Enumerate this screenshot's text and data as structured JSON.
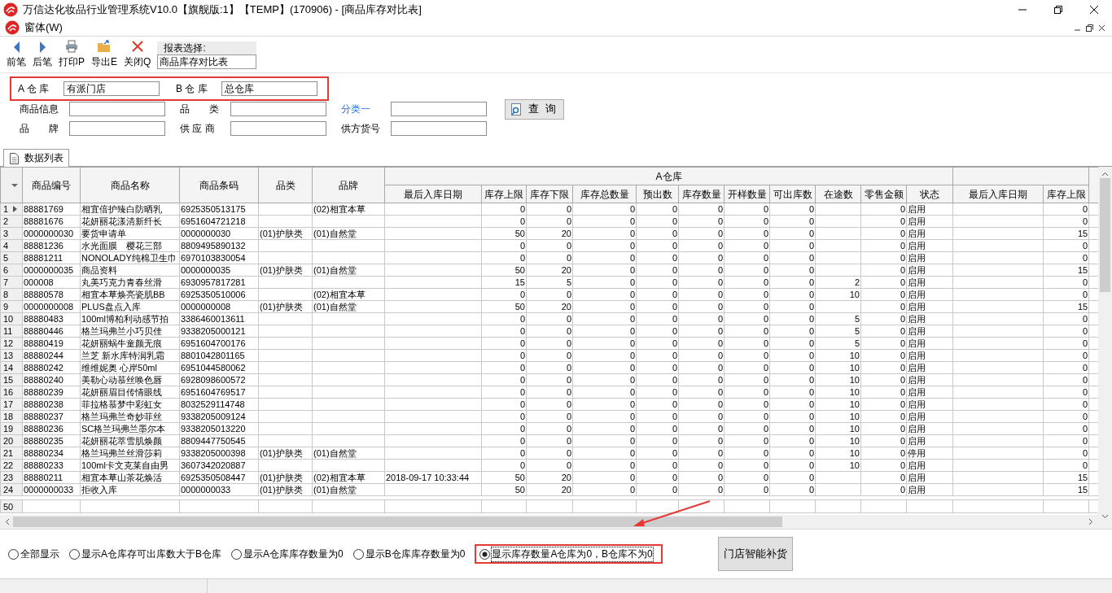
{
  "window": {
    "title": "万信达化妆品行业管理系统V10.0【旗舰版:1】【TEMP】(170906) - [商品库存对比表]"
  },
  "menu": [
    {
      "label": "窗体(W)"
    }
  ],
  "toolbar": {
    "buttons": [
      {
        "label": "前笔"
      },
      {
        "label": "后笔"
      },
      {
        "label": "打印P"
      },
      {
        "label": "导出E"
      },
      {
        "label": "关闭Q"
      }
    ],
    "report_select": {
      "label": "报表选择:",
      "value": "商品库存对比表"
    }
  },
  "filter": {
    "highlighted": true,
    "warehouse_a": {
      "label": "A 仓 库",
      "value": "有派门店"
    },
    "warehouse_b": {
      "label": "B 仓 库",
      "value": "总仓库"
    },
    "fields": [
      {
        "label": "商品信息",
        "kind": "text"
      },
      {
        "label": "品　　类",
        "kind": "text"
      },
      {
        "label": "分类一",
        "kind": "link"
      },
      {
        "label": "品　　牌",
        "kind": "text"
      },
      {
        "label": "供 应 商",
        "kind": "text"
      },
      {
        "label": "供方货号",
        "kind": "text"
      }
    ],
    "query_button": "查 询"
  },
  "tabs": [
    {
      "label": "数据列表",
      "selected": true
    }
  ],
  "grid": {
    "columns": [
      {
        "label": "商品编号"
      },
      {
        "label": "商品名称"
      },
      {
        "label": "商品条码"
      },
      {
        "label": "品类"
      },
      {
        "label": "品牌"
      }
    ],
    "column_groups": [
      {
        "label": "A仓库",
        "columns": [
          {
            "label": "最后入库日期"
          },
          {
            "label": "库存上限"
          },
          {
            "label": "库存下限"
          },
          {
            "label": "库存总数量"
          },
          {
            "label": "预出数"
          },
          {
            "label": "库存数量"
          },
          {
            "label": "开样数量"
          },
          {
            "label": "可出库数"
          },
          {
            "label": "在途数"
          },
          {
            "label": "零售金额"
          },
          {
            "label": "状态"
          }
        ]
      },
      {
        "columns": [
          {
            "label": "最后入库日期"
          },
          {
            "label": "库存上限"
          }
        ]
      }
    ],
    "rows": [
      {
        "header": "1",
        "kind": "data",
        "current": true,
        "cells": [
          "88881769",
          "相宜倍护臻白防晒乳",
          "6925350513175",
          null,
          "(02)相宜本草",
          null,
          "0",
          "0",
          "0",
          "0",
          "0",
          "0",
          "0",
          null,
          "0",
          "启用",
          null,
          "0"
        ]
      },
      {
        "header": "2",
        "kind": "data",
        "current": false,
        "cells": [
          "88881676",
          "花妍丽花漾清新纤长",
          "6951604721218",
          null,
          null,
          null,
          "0",
          "0",
          "0",
          "0",
          "0",
          "0",
          "0",
          null,
          "0",
          "启用",
          null,
          "0"
        ]
      },
      {
        "header": "3",
        "kind": "data",
        "current": false,
        "cells": [
          "0000000030",
          "要货申请单",
          "0000000030",
          "(01)护肤类",
          "(01)自然堂",
          null,
          "50",
          "20",
          "0",
          "0",
          "0",
          "0",
          "0",
          null,
          "0",
          "启用",
          null,
          "15"
        ]
      },
      {
        "header": "4",
        "kind": "data",
        "current": false,
        "cells": [
          "88881236",
          "水光面膜　樱花三部",
          "8809495890132",
          null,
          null,
          null,
          "0",
          "0",
          "0",
          "0",
          "0",
          "0",
          "0",
          null,
          "0",
          "启用",
          null,
          "0"
        ]
      },
      {
        "header": "5",
        "kind": "data",
        "current": false,
        "cells": [
          "88881211",
          "NONOLADY纯棉卫生巾",
          "6970103830054",
          null,
          null,
          null,
          "0",
          "0",
          "0",
          "0",
          "0",
          "0",
          "0",
          null,
          "0",
          "启用",
          null,
          "0"
        ]
      },
      {
        "header": "6",
        "kind": "data",
        "current": false,
        "cells": [
          "0000000035",
          "商品资料",
          "0000000035",
          "(01)护肤类",
          "(01)自然堂",
          null,
          "50",
          "20",
          "0",
          "0",
          "0",
          "0",
          "0",
          null,
          "0",
          "启用",
          null,
          "15"
        ]
      },
      {
        "header": "7",
        "kind": "data",
        "current": false,
        "cells": [
          "000008",
          "丸美巧克力青春丝滑",
          "6930957817281",
          null,
          null,
          null,
          "15",
          "5",
          "0",
          "0",
          "0",
          "0",
          "0",
          "2",
          "0",
          "启用",
          null,
          "0"
        ]
      },
      {
        "header": "8",
        "kind": "data",
        "current": false,
        "cells": [
          "88880578",
          "相宜本草焕亮瓷肌BB",
          "6925350510006",
          null,
          "(02)相宜本草",
          null,
          "0",
          "0",
          "0",
          "0",
          "0",
          "0",
          "0",
          "10",
          "0",
          "启用",
          null,
          "0"
        ]
      },
      {
        "header": "9",
        "kind": "data",
        "current": false,
        "cells": [
          "0000000008",
          "PLUS盘点入库",
          "0000000008",
          "(01)护肤类",
          "(01)自然堂",
          null,
          "50",
          "20",
          "0",
          "0",
          "0",
          "0",
          "0",
          null,
          "0",
          "启用",
          null,
          "15"
        ]
      },
      {
        "header": "10",
        "kind": "data",
        "current": false,
        "cells": [
          "88880483",
          "100ml博柏利动感节拍",
          "3386460013611",
          null,
          null,
          null,
          "0",
          "0",
          "0",
          "0",
          "0",
          "0",
          "0",
          "5",
          "0",
          "启用",
          null,
          "0"
        ]
      },
      {
        "header": "11",
        "kind": "data",
        "current": false,
        "cells": [
          "88880446",
          "格兰玛弗兰小巧贝佳",
          "9338205000121",
          null,
          null,
          null,
          "0",
          "0",
          "0",
          "0",
          "0",
          "0",
          "0",
          "5",
          "0",
          "启用",
          null,
          "0"
        ]
      },
      {
        "header": "12",
        "kind": "data",
        "current": false,
        "cells": [
          "88880419",
          "花妍丽蜗牛童颜无痕",
          "6951604700176",
          null,
          null,
          null,
          "0",
          "0",
          "0",
          "0",
          "0",
          "0",
          "0",
          "5",
          "0",
          "启用",
          null,
          "0"
        ]
      },
      {
        "header": "13",
        "kind": "data",
        "current": false,
        "cells": [
          "88880244",
          "兰芝 新水库特润乳霜",
          "8801042801165",
          null,
          null,
          null,
          "0",
          "0",
          "0",
          "0",
          "0",
          "0",
          "0",
          "10",
          "0",
          "启用",
          null,
          "0"
        ]
      },
      {
        "header": "14",
        "kind": "data",
        "current": false,
        "cells": [
          "88880242",
          "维维妮奥 心岸50ml",
          "6951044580062",
          null,
          null,
          null,
          "0",
          "0",
          "0",
          "0",
          "0",
          "0",
          "0",
          "10",
          "0",
          "启用",
          null,
          "0"
        ]
      },
      {
        "header": "15",
        "kind": "data",
        "current": false,
        "cells": [
          "88880240",
          "美勒心动慕丝唤色唇",
          "6928098600572",
          null,
          null,
          null,
          "0",
          "0",
          "0",
          "0",
          "0",
          "0",
          "0",
          "10",
          "0",
          "启用",
          null,
          "0"
        ]
      },
      {
        "header": "16",
        "kind": "data",
        "current": false,
        "cells": [
          "88880239",
          "花妍丽眉目传情眼线",
          "6951604769517",
          null,
          null,
          null,
          "0",
          "0",
          "0",
          "0",
          "0",
          "0",
          "0",
          "10",
          "0",
          "启用",
          null,
          "0"
        ]
      },
      {
        "header": "17",
        "kind": "data",
        "current": false,
        "cells": [
          "88880238",
          "菲拉格慕梦中彩虹女",
          "8032529114748",
          null,
          null,
          null,
          "0",
          "0",
          "0",
          "0",
          "0",
          "0",
          "0",
          "10",
          "0",
          "启用",
          null,
          "0"
        ]
      },
      {
        "header": "18",
        "kind": "data",
        "current": false,
        "cells": [
          "88880237",
          "格兰玛弗兰奇妙菲丝",
          "9338205009124",
          null,
          null,
          null,
          "0",
          "0",
          "0",
          "0",
          "0",
          "0",
          "0",
          "10",
          "0",
          "启用",
          null,
          "0"
        ]
      },
      {
        "header": "19",
        "kind": "data",
        "current": false,
        "cells": [
          "88880236",
          "SC格兰玛弗兰墨尔本",
          "9338205013220",
          null,
          null,
          null,
          "0",
          "0",
          "0",
          "0",
          "0",
          "0",
          "0",
          "10",
          "0",
          "启用",
          null,
          "0"
        ]
      },
      {
        "header": "20",
        "kind": "data",
        "current": false,
        "cells": [
          "88880235",
          "花妍丽花萃雪肌焕颜",
          "8809447750545",
          null,
          null,
          null,
          "0",
          "0",
          "0",
          "0",
          "0",
          "0",
          "0",
          "10",
          "0",
          "启用",
          null,
          "0"
        ]
      },
      {
        "header": "21",
        "kind": "data",
        "current": false,
        "cells": [
          "88880234",
          "格兰玛弗兰丝滑莎莉",
          "9338205000398",
          "(01)护肤类",
          "(01)自然堂",
          null,
          "0",
          "0",
          "0",
          "0",
          "0",
          "0",
          "0",
          "10",
          "0",
          "停用",
          null,
          "0"
        ]
      },
      {
        "header": "22",
        "kind": "data",
        "current": false,
        "cells": [
          "88880233",
          "100ml卡文克莱自由男",
          "3607342020887",
          null,
          null,
          null,
          "0",
          "0",
          "0",
          "0",
          "0",
          "0",
          "0",
          "10",
          "0",
          "启用",
          null,
          "0"
        ]
      },
      {
        "header": "23",
        "kind": "data",
        "current": false,
        "cells": [
          "88880211",
          "相宜本草山茶花焕活",
          "6925350508447",
          "(01)护肤类",
          "(02)相宜本草",
          "2018-09-17 10:33:44",
          "50",
          "20",
          "0",
          "0",
          "0",
          "0",
          "0",
          null,
          "0",
          "启用",
          null,
          "15"
        ]
      },
      {
        "header": "24",
        "kind": "data",
        "current": false,
        "cells": [
          "0000000033",
          "拒收入库",
          "0000000033",
          "(01)护肤类",
          "(01)自然堂",
          null,
          "50",
          "20",
          "0",
          "0",
          "0",
          "0",
          "0",
          null,
          "0",
          "启用",
          null,
          "15"
        ]
      },
      {
        "header": "50",
        "kind": "new",
        "current": false
      }
    ]
  },
  "options": [
    {
      "label": "全部显示",
      "selected": false,
      "highlighted": false
    },
    {
      "label": "显示A仓库存可出库数大于B仓库",
      "selected": false,
      "highlighted": false
    },
    {
      "label": "显示A仓库库存数量为0",
      "selected": false,
      "highlighted": false
    },
    {
      "label": "显示B仓库库存数量为0",
      "selected": false,
      "highlighted": false
    },
    {
      "label": "显示库存数量A仓库为0，B仓库不为0",
      "selected": true,
      "highlighted": true
    }
  ],
  "action_button": "门店智能补货"
}
